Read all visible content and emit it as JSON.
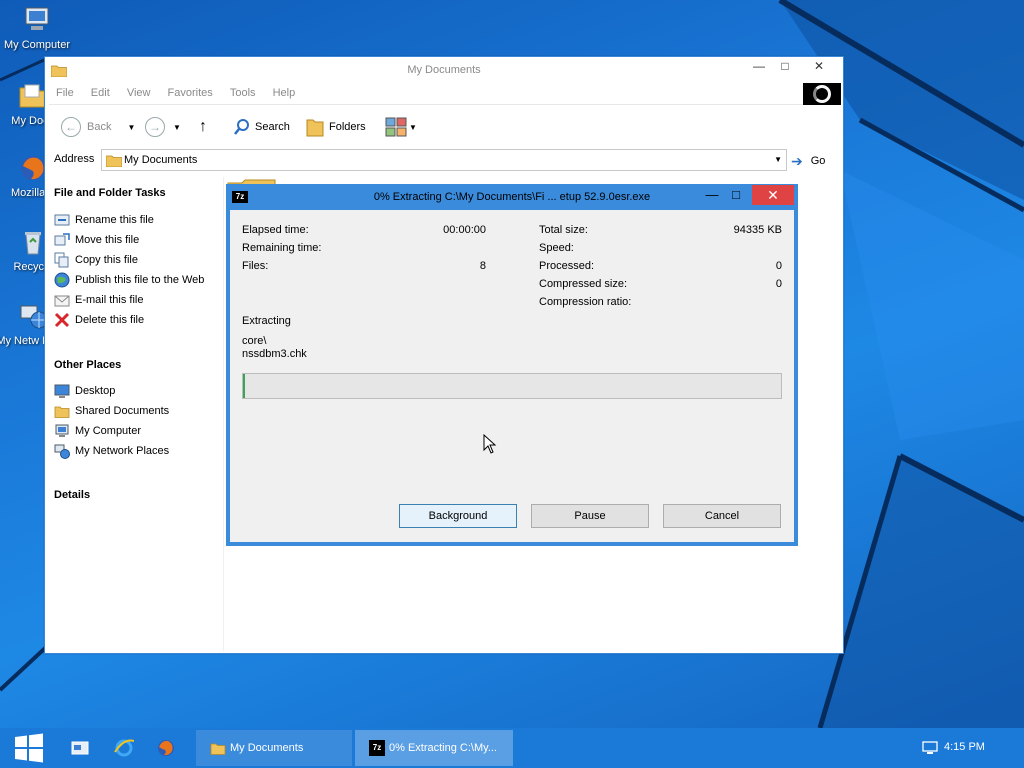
{
  "desktop": {
    "icons": [
      {
        "label": "My Computer",
        "icon": "computer-icon"
      },
      {
        "label": "My Docu",
        "icon": "documents-folder-icon"
      },
      {
        "label": "Mozilla F",
        "icon": "firefox-icon"
      },
      {
        "label": "Recycle",
        "icon": "recycle-bin-icon"
      },
      {
        "label": "My Netw Place",
        "icon": "network-places-icon"
      }
    ]
  },
  "explorer": {
    "title": "My Documents",
    "controls": {
      "minimize": "—",
      "maximize": "□",
      "close": "✕"
    },
    "menu": [
      "File",
      "Edit",
      "View",
      "Favorites",
      "Tools",
      "Help"
    ],
    "toolbar": {
      "back_label": "Back",
      "search_label": "Search",
      "folders_label": "Folders"
    },
    "address": {
      "label": "Address",
      "value": "My Documents",
      "go_label": "Go"
    },
    "tasks": {
      "file_folder_heading": "File and Folder Tasks",
      "file_folder_items": [
        {
          "label": "Rename this file",
          "icon": "rename-icon"
        },
        {
          "label": "Move this file",
          "icon": "move-icon"
        },
        {
          "label": "Copy this file",
          "icon": "copy-icon"
        },
        {
          "label": "Publish this file to the Web",
          "icon": "globe-icon"
        },
        {
          "label": "E-mail this file",
          "icon": "email-icon"
        },
        {
          "label": "Delete this file",
          "icon": "delete-icon"
        }
      ],
      "other_places_heading": "Other Places",
      "other_places_items": [
        {
          "label": "Desktop",
          "icon": "desktop-icon"
        },
        {
          "label": "Shared Documents",
          "icon": "folder-icon"
        },
        {
          "label": "My Computer",
          "icon": "computer-icon"
        },
        {
          "label": "My Network Places",
          "icon": "network-icon"
        }
      ],
      "details_heading": "Details"
    }
  },
  "dialog": {
    "title": "0% Extracting C:\\My Documents\\Fi ... etup 52.9.0esr.exe",
    "logo": "7z",
    "controls": {
      "minimize": "—",
      "maximize": "□",
      "close": "✕"
    },
    "stats_left": [
      {
        "label": "Elapsed time:",
        "value": "00:00:00"
      },
      {
        "label": "Remaining time:",
        "value": ""
      },
      {
        "label": "Files:",
        "value": "8"
      }
    ],
    "stats_right": [
      {
        "label": "Total size:",
        "value": "94335 KB"
      },
      {
        "label": "Speed:",
        "value": ""
      },
      {
        "label": "Processed:",
        "value": "0"
      },
      {
        "label": "Compressed size:",
        "value": "0"
      },
      {
        "label": "Compression ratio:",
        "value": ""
      }
    ],
    "status": "Extracting",
    "current_path": "core\\",
    "current_file": "nssdbm3.chk",
    "progress_percent": 0,
    "buttons": {
      "background": "Background",
      "pause": "Pause",
      "cancel": "Cancel"
    }
  },
  "taskbar": {
    "tasks": [
      {
        "label": "My Documents",
        "icon": "folder-icon"
      },
      {
        "label": "0% Extracting C:\\My...",
        "icon": "7zip-icon"
      }
    ],
    "clock": "4:15 PM"
  },
  "colors": {
    "accent": "#3b8bdc",
    "taskbar": "#1b79d8",
    "close_red": "#e04343",
    "progress_green": "#06b025"
  }
}
